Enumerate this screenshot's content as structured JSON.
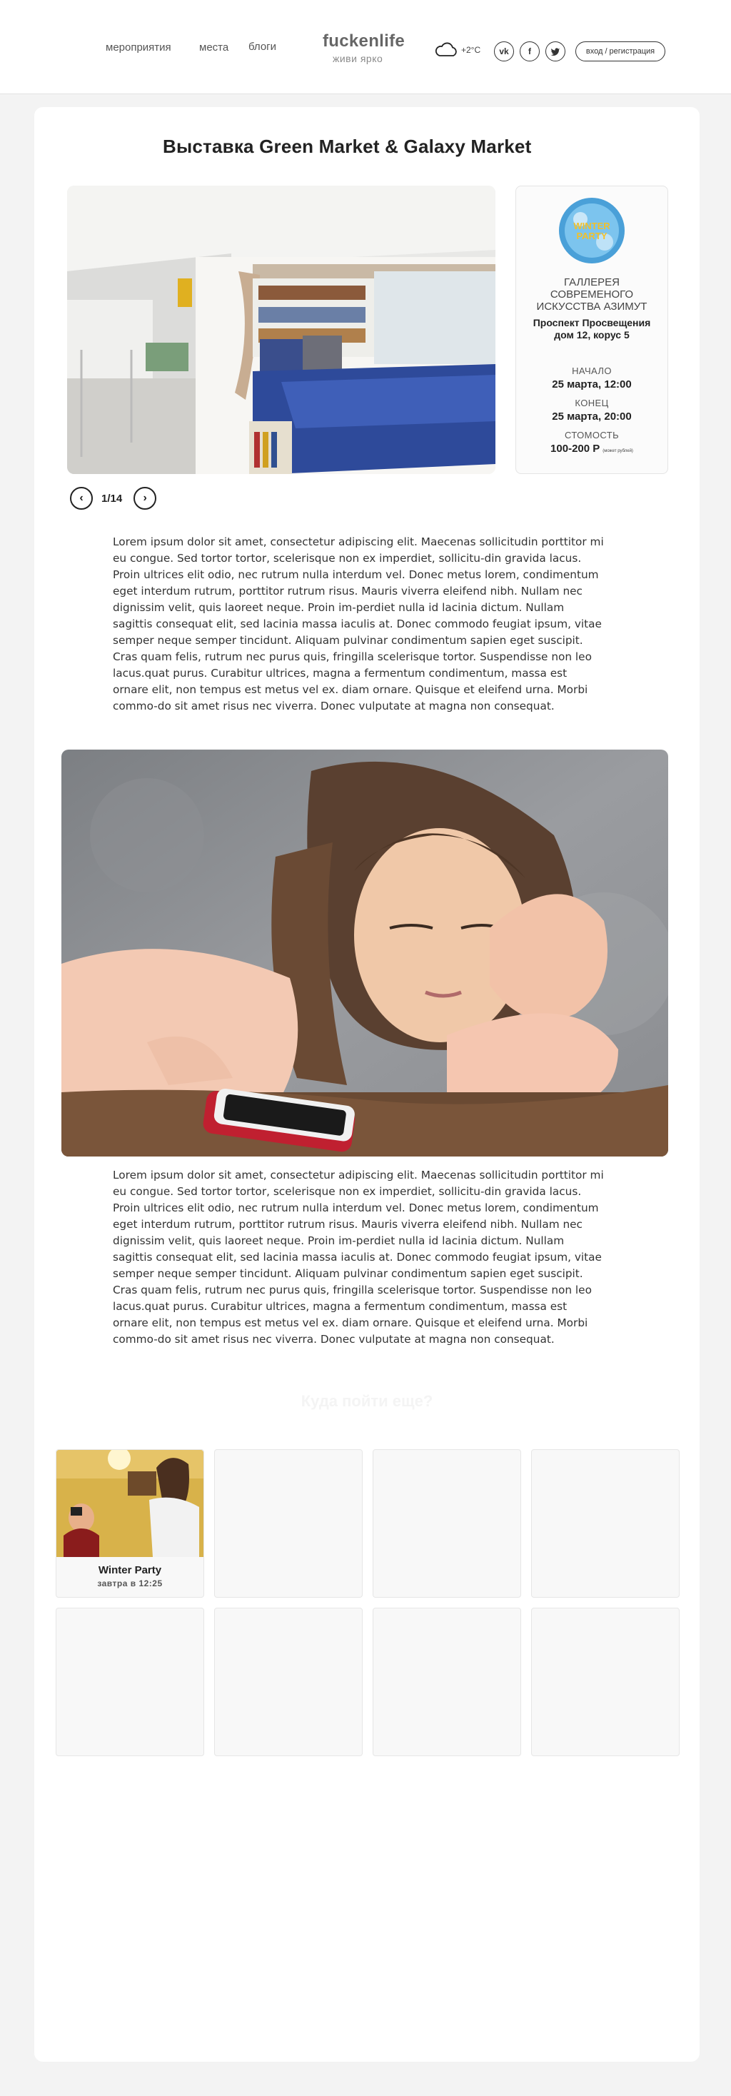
{
  "header": {
    "nav": [
      "мероприятия",
      "места",
      "блоги"
    ],
    "logo_title": "fuckenlife",
    "logo_subtitle": "живи ярко",
    "weather_temp": "+2°C",
    "socials": [
      "vk-icon",
      "facebook-icon",
      "twitter-icon"
    ],
    "login_label": "вход / регистрация"
  },
  "event": {
    "title": "Выставка Green Market & Galaxy Market",
    "pager": "1/14",
    "venue_name": "ГАЛЛЕРЕЯ СОВРЕМЕНОГО ИСКУССТВА АЗИМУТ",
    "venue_address": "Проспект Просвещения дом 12, корус 5",
    "start_label": "НАЧАЛО",
    "start_value": "25 марта, 12:00",
    "end_label": "КОНЕЦ",
    "end_value": "25 марта, 20:00",
    "price_label": "СТОМОСТЬ",
    "price_value": "100-200 Р",
    "price_note": "(может рублей)",
    "venue_logo_text": "WINTER PARTY",
    "paragraph_1": "Lorem ipsum dolor sit amet, consectetur adipiscing elit. Maecenas sollicitudin porttitor mi eu congue. Sed tortor tortor, scelerisque non ex imperdiet, sollicitu-din gravida lacus. Proin ultrices elit odio, nec rutrum nulla interdum vel. Donec metus lorem, condimentum eget interdum rutrum, porttitor rutrum risus. Mauris viverra eleifend nibh. Nullam nec dignissim velit, quis laoreet neque. Proin im-perdiet nulla id lacinia dictum. Nullam sagittis consequat elit, sed lacinia massa iaculis at. Donec commodo feugiat ipsum, vitae semper neque semper tincidunt. Aliquam pulvinar condimentum sapien eget suscipit. Cras quam felis, rutrum nec purus quis, fringilla scelerisque tortor. Suspendisse non leo lacus.quat purus. Curabitur ultrices, magna a fermentum condimentum, massa est ornare elit, non tempus est metus vel ex. diam ornare. Quisque et eleifend urna. Morbi commo-do sit amet risus nec viverra. Donec vulputate at magna non consequat.",
    "paragraph_2": "Lorem ipsum dolor sit amet, consectetur adipiscing elit. Maecenas sollicitudin porttitor mi eu congue. Sed tortor tortor, scelerisque non ex imperdiet, sollicitu-din gravida lacus. Proin ultrices elit odio, nec rutrum nulla interdum vel. Donec metus lorem, condimentum eget interdum rutrum, porttitor rutrum risus. Mauris viverra eleifend nibh. Nullam nec dignissim velit, quis laoreet neque. Proin im-perdiet nulla id lacinia dictum. Nullam sagittis consequat elit, sed lacinia massa iaculis at. Donec commodo feugiat ipsum, vitae semper neque semper tincidunt. Aliquam pulvinar condimentum sapien eget suscipit. Cras quam felis, rutrum nec purus quis, fringilla scelerisque tortor. Suspendisse non leo lacus.quat purus. Curabitur ultrices, magna a fermentum condimentum, massa est ornare elit, non tempus est metus vel ex. diam ornare. Quisque et eleifend urna. Morbi commo-do sit amet risus nec viverra. Donec vulputate at magna non consequat."
  },
  "more": {
    "title": "Куда пойти еще?",
    "tiles": [
      {
        "title": "Winter Party",
        "time": "завтра в 12:25"
      }
    ]
  }
}
